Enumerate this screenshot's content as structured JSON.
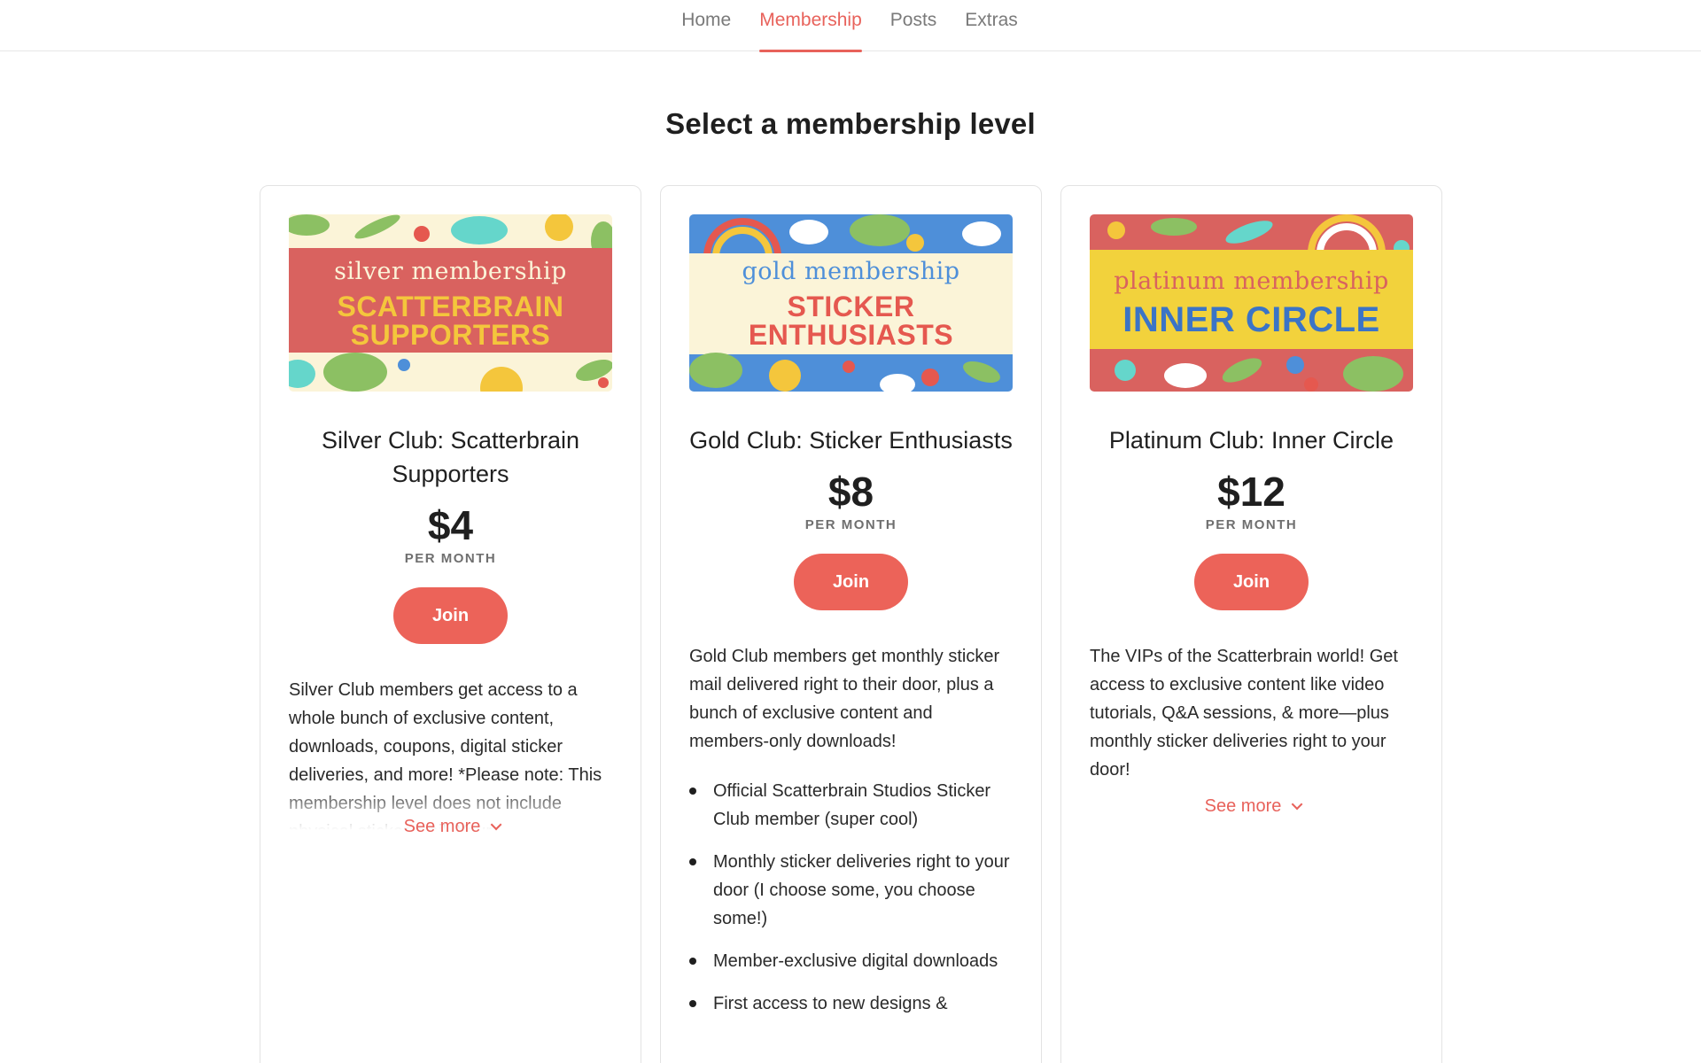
{
  "nav": {
    "tabs": [
      {
        "label": "Home"
      },
      {
        "label": "Membership"
      },
      {
        "label": "Posts"
      },
      {
        "label": "Extras"
      }
    ],
    "active_tab": "Membership"
  },
  "page_title": "Select a membership level",
  "colors": {
    "accent": "#e8625b",
    "join_button": "#ec6359",
    "silver_band": "#d9625f",
    "gold_band": "#fbf4d8",
    "platinum_band": "#f2d23c"
  },
  "tiers": [
    {
      "banner_line1": "silver membership",
      "banner_line2a": "SCATTERBRAIN",
      "banner_line2b": "SUPPORTERS",
      "title": "Silver Club: Scatterbrain Supporters",
      "price": "$4",
      "period": "PER MONTH",
      "join_label": "Join",
      "description": "Silver Club members get access to a whole bunch of exclusive content, downloads, coupons, digital sticker deliveries, and more! *Please note: This membership level does not include physical sticker mail. Your",
      "see_more": "See more"
    },
    {
      "banner_line1": "gold membership",
      "banner_line2a": "STICKER",
      "banner_line2b": "ENTHUSIASTS",
      "title": "Gold Club: Sticker Enthusiasts",
      "price": "$8",
      "period": "PER MONTH",
      "join_label": "Join",
      "description": "Gold Club members get monthly sticker mail delivered right to their door, plus a bunch of exclusive content and members-only downloads!",
      "benefits": [
        "Official Scatterbrain Studios Sticker Club member (super cool)",
        "Monthly sticker deliveries right to your door (I choose some, you choose some!)",
        "Member-exclusive digital downloads",
        "First access to new designs &"
      ]
    },
    {
      "banner_line1": "platinum membership",
      "banner_line2a": "INNER CIRCLE",
      "title": "Platinum Club: Inner Circle",
      "price": "$12",
      "period": "PER MONTH",
      "join_label": "Join",
      "description": "The VIPs of the Scatterbrain world! Get access to exclusive content like video tutorials, Q&A sessions, & more—plus monthly sticker deliveries right to your door!",
      "see_more": "See more"
    }
  ]
}
